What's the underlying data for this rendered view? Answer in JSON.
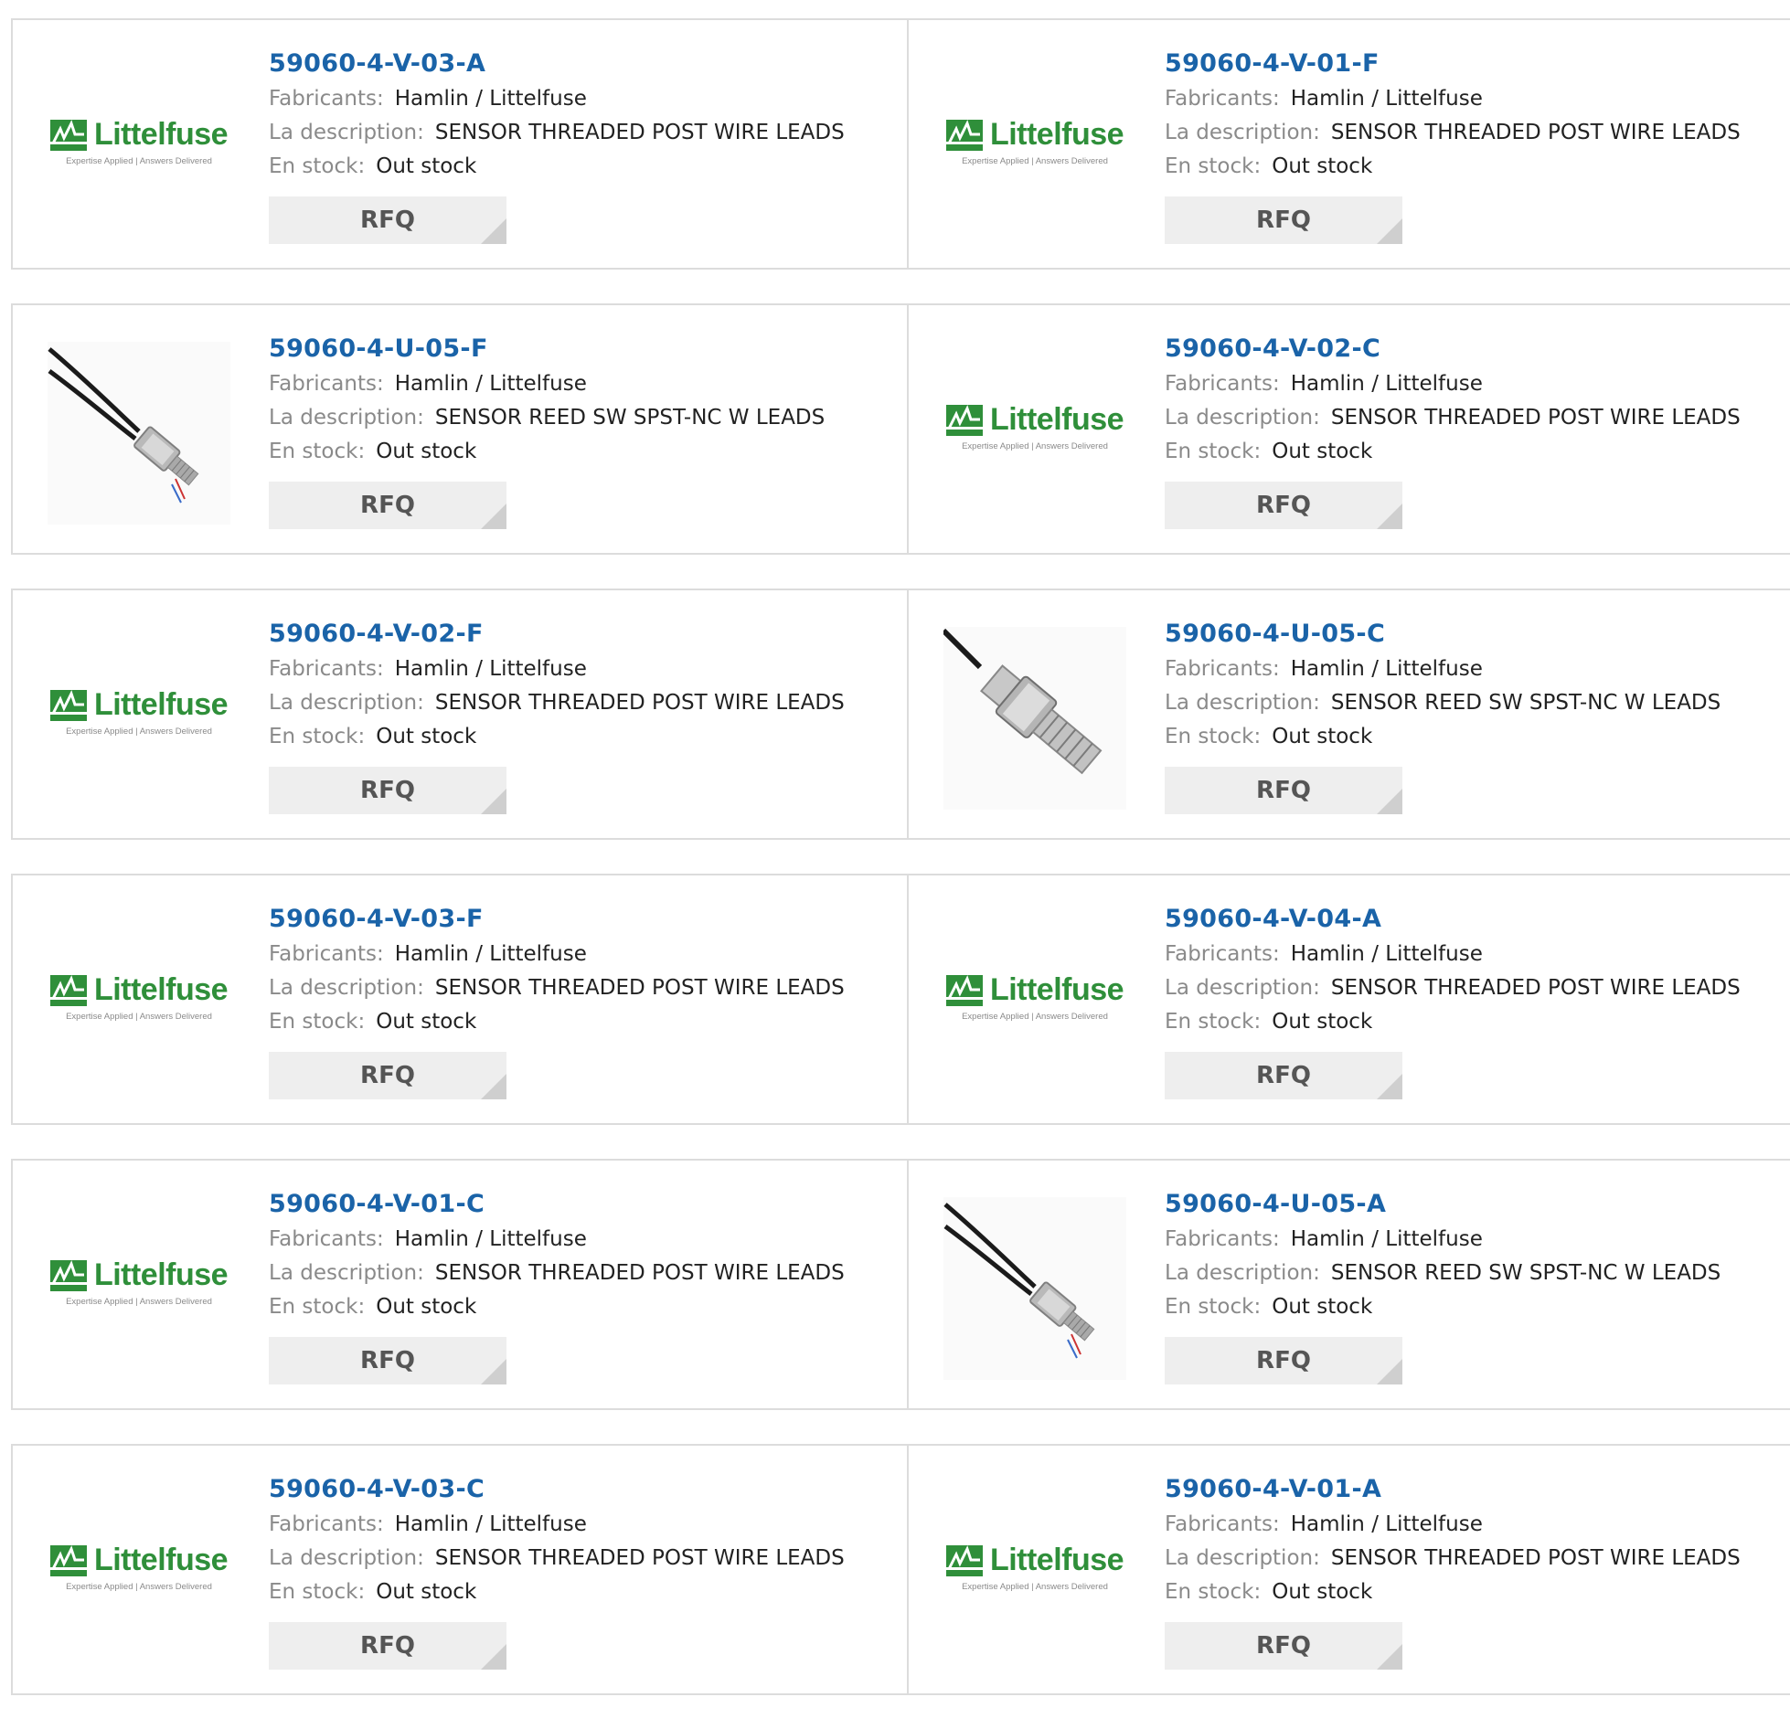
{
  "labels": {
    "manufacturer": "Fabricants:",
    "description": "La description:",
    "stock": "En stock:",
    "rfq": "RFQ"
  },
  "logo": {
    "word": "Littelfuse",
    "tagline": "Expertise Applied | Answers Delivered"
  },
  "products": [
    {
      "part": "59060-4-V-03-A",
      "manufacturer": "Hamlin / Littelfuse",
      "description": "SENSOR THREADED POST WIRE LEADS",
      "stock": "Out stock",
      "image": "logo"
    },
    {
      "part": "59060-4-V-01-F",
      "manufacturer": "Hamlin / Littelfuse",
      "description": "SENSOR THREADED POST WIRE LEADS",
      "stock": "Out stock",
      "image": "logo"
    },
    {
      "part": "59060-4-U-05-F",
      "manufacturer": "Hamlin / Littelfuse",
      "description": "SENSOR REED SW SPST-NC W LEADS",
      "stock": "Out stock",
      "image": "sensor-wires"
    },
    {
      "part": "59060-4-V-02-C",
      "manufacturer": "Hamlin / Littelfuse",
      "description": "SENSOR THREADED POST WIRE LEADS",
      "stock": "Out stock",
      "image": "logo"
    },
    {
      "part": "59060-4-V-02-F",
      "manufacturer": "Hamlin / Littelfuse",
      "description": "SENSOR THREADED POST WIRE LEADS",
      "stock": "Out stock",
      "image": "logo"
    },
    {
      "part": "59060-4-U-05-C",
      "manufacturer": "Hamlin / Littelfuse",
      "description": "SENSOR REED SW SPST-NC W LEADS",
      "stock": "Out stock",
      "image": "sensor-closeup"
    },
    {
      "part": "59060-4-V-03-F",
      "manufacturer": "Hamlin / Littelfuse",
      "description": "SENSOR THREADED POST WIRE LEADS",
      "stock": "Out stock",
      "image": "logo"
    },
    {
      "part": "59060-4-V-04-A",
      "manufacturer": "Hamlin / Littelfuse",
      "description": "SENSOR THREADED POST WIRE LEADS",
      "stock": "Out stock",
      "image": "logo"
    },
    {
      "part": "59060-4-V-01-C",
      "manufacturer": "Hamlin / Littelfuse",
      "description": "SENSOR THREADED POST WIRE LEADS",
      "stock": "Out stock",
      "image": "logo"
    },
    {
      "part": "59060-4-U-05-A",
      "manufacturer": "Hamlin / Littelfuse",
      "description": "SENSOR REED SW SPST-NC W LEADS",
      "stock": "Out stock",
      "image": "sensor-wires"
    },
    {
      "part": "59060-4-V-03-C",
      "manufacturer": "Hamlin / Littelfuse",
      "description": "SENSOR THREADED POST WIRE LEADS",
      "stock": "Out stock",
      "image": "logo"
    },
    {
      "part": "59060-4-V-01-A",
      "manufacturer": "Hamlin / Littelfuse",
      "description": "SENSOR THREADED POST WIRE LEADS",
      "stock": "Out stock",
      "image": "logo"
    }
  ],
  "colors": {
    "part_link": "#1a63a8",
    "label": "#8a8a8a",
    "brand_green": "#2f8f3a",
    "border": "#dcdcdc",
    "button_bg": "#eeeeee"
  }
}
